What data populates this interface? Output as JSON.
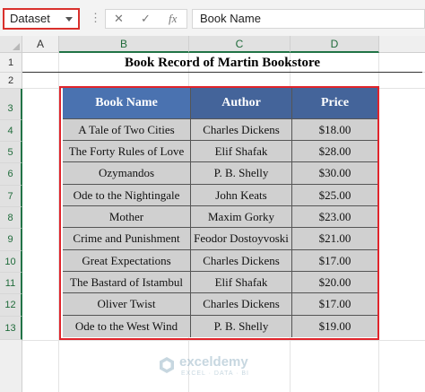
{
  "name_box": "Dataset",
  "formula_bar": {
    "cancel_icon": "x-icon",
    "enter_icon": "check-icon",
    "fx_label": "fx",
    "content": "Book Name"
  },
  "columns": [
    "A",
    "B",
    "C",
    "D"
  ],
  "rows": [
    "1",
    "2",
    "3",
    "4",
    "5",
    "6",
    "7",
    "8",
    "9",
    "10",
    "11",
    "12",
    "13"
  ],
  "title": "Book Record of Martin Bookstore",
  "table": {
    "headers": [
      "Book Name",
      "Author",
      "Price"
    ],
    "rows": [
      [
        "A Tale of Two Cities",
        "Charles Dickens",
        "$18.00"
      ],
      [
        "The Forty Rules of Love",
        "Elif Shafak",
        "$28.00"
      ],
      [
        "Ozymandos",
        "P. B. Shelly",
        "$30.00"
      ],
      [
        "Ode to the Nightingale",
        "John Keats",
        "$25.00"
      ],
      [
        "Mother",
        "Maxim Gorky",
        "$23.00"
      ],
      [
        "Crime and Punishment",
        "Feodor Dostoyvoski",
        "$21.00"
      ],
      [
        "Great Expectations",
        "Charles Dickens",
        "$17.00"
      ],
      [
        "The Bastard of Istambul",
        "Elif Shafak",
        "$20.00"
      ],
      [
        "Oliver Twist",
        "Charles Dickens",
        "$17.00"
      ],
      [
        "Ode to the West Wind",
        "P. B. Shelly",
        "$19.00"
      ]
    ]
  },
  "watermark": {
    "name": "exceldemy",
    "tagline": "EXCEL · DATA · BI"
  },
  "colors": {
    "header_blue": "#44649a",
    "selection_red": "#e0242b",
    "excel_green": "#217346",
    "cell_gray": "#d0d0d0"
  }
}
